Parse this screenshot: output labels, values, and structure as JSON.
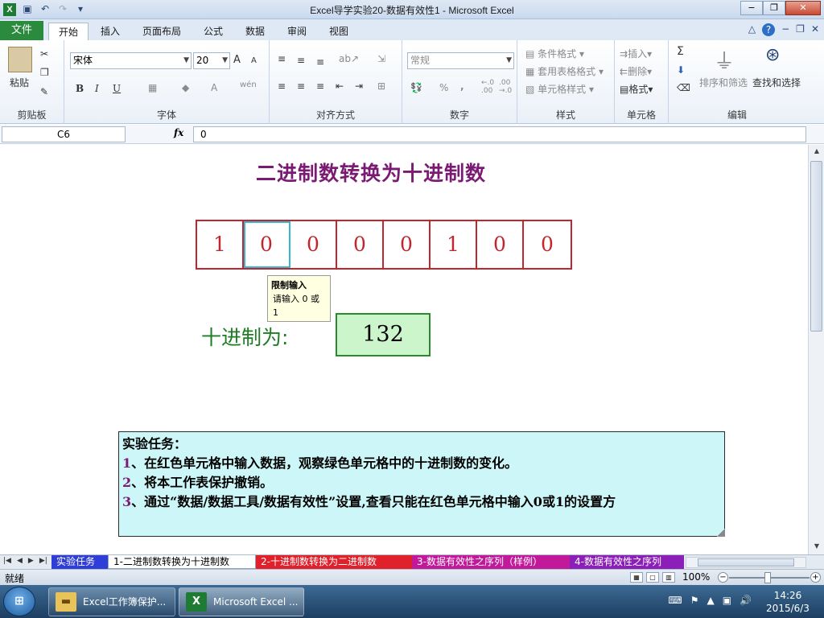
{
  "window": {
    "title": "Excel导学实验20-数据有效性1  -  Microsoft Excel",
    "app_icon": "X",
    "qat_icons": [
      "save-icon",
      "undo-icon",
      "redo-icon",
      "customize-qat-icon"
    ],
    "controls": [
      "−",
      "❐",
      "✕"
    ]
  },
  "ribbon_tabs": {
    "file": "文件",
    "tabs": [
      "开始",
      "插入",
      "页面布局",
      "公式",
      "数据",
      "审阅",
      "视图"
    ],
    "active": "开始",
    "right_icons": [
      "△",
      "?",
      "−",
      "❐",
      "✕"
    ]
  },
  "ribbon": {
    "clipboard": {
      "label": "剪贴板",
      "paste": "粘贴"
    },
    "font": {
      "label": "字体",
      "name": "宋体",
      "size": "20",
      "bold": "B",
      "italic": "I",
      "underline": "U",
      "grow": "A",
      "shrink": "A",
      "wen": "wén"
    },
    "alignment": {
      "label": "对齐方式"
    },
    "number": {
      "label": "数字",
      "format": "常规",
      "percent": "%",
      "comma": ",",
      "inc": "←.0 .00",
      "dec": ".00 →.0"
    },
    "styles": {
      "label": "样式",
      "conditional": "条件格式",
      "table": "套用表格格式",
      "cell": "单元格样式"
    },
    "cells": {
      "label": "单元格",
      "insert": "插入",
      "delete": "删除",
      "format": "格式"
    },
    "editing": {
      "label": "编辑",
      "sum": "Σ",
      "sort_filter": "排序和筛选",
      "find_select": "查找和选择"
    }
  },
  "formula_bar": {
    "name_box": "C6",
    "fx": "fx",
    "value": "0"
  },
  "sheet": {
    "title": "二进制数转换为十进制数",
    "bits": [
      "1",
      "0",
      "0",
      "0",
      "0",
      "1",
      "0",
      "0"
    ],
    "selected_index": 1,
    "tooltip": {
      "title": "限制输入",
      "body": "请输入 0 或\n1"
    },
    "decimal_label": "十进制为:",
    "decimal_value": "132",
    "task": {
      "heading": "实验任务：",
      "items": [
        {
          "num": "1",
          "text": "、在红色单元格中输入数据，观察绿色单元格中的十进制数的变化。"
        },
        {
          "num": "2",
          "text": "、将本工作表保护撤销。"
        },
        {
          "num": "3",
          "text": "、通过“数据/数据工具/数据有效性”设置,查看只能在红色单元格中输入0或1的设置方"
        }
      ]
    }
  },
  "sheet_tabs": [
    {
      "label": "实验任务",
      "color": "#2f3ed6",
      "text_color": "#ffffff"
    },
    {
      "label": "1-二进制数转换为十进制数",
      "color": "#ffffff",
      "text_color": "#000000",
      "active": true
    },
    {
      "label": "2-十进制数转换为二进制数",
      "color": "#e0202a",
      "text_color": "#ffffff"
    },
    {
      "label": "3-数据有效性之序列（样例）",
      "color": "#c2189a",
      "text_color": "#ffffff"
    },
    {
      "label": "4-数据有效性之序列",
      "color": "#8b1fb8",
      "text_color": "#ffffff"
    }
  ],
  "status": {
    "ready": "就绪",
    "zoom": "100%"
  },
  "taskbar": {
    "buttons": [
      {
        "label": "Excel工作簿保护...",
        "icon": "folder-icon"
      },
      {
        "label": "Microsoft Excel ...",
        "icon": "excel-icon"
      }
    ],
    "time": "14:26",
    "date": "2015/6/3"
  },
  "colors": {
    "bit_red": "#c0262e",
    "title_purple": "#7b1a72",
    "dec_green": "#1e7d24",
    "dec_fill": "#ccf5cc",
    "task_fill": "#ccf6f7"
  }
}
